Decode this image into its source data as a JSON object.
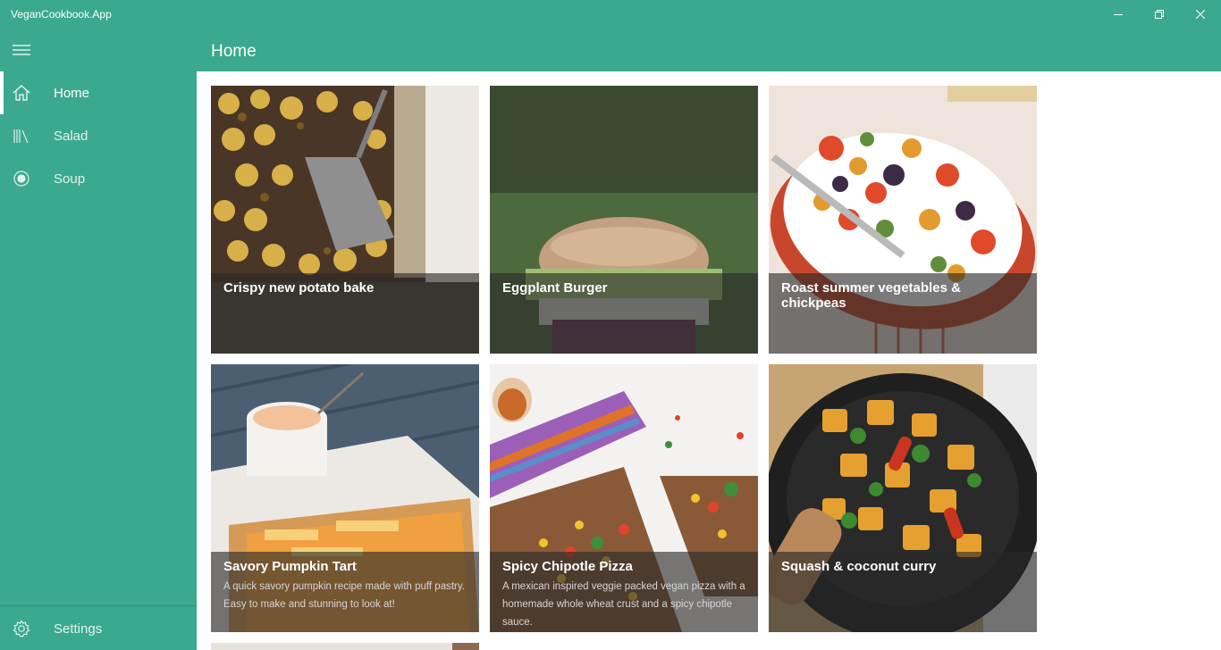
{
  "window": {
    "title": "VeganCookbook.App"
  },
  "header": {
    "title": "Home"
  },
  "sidebar": {
    "items": [
      {
        "label": "Home",
        "icon": "home-icon",
        "active": true
      },
      {
        "label": "Salad",
        "icon": "library-icon",
        "active": false
      },
      {
        "label": "Soup",
        "icon": "radio-button-icon",
        "active": false
      }
    ],
    "settings_label": "Settings"
  },
  "recipes": [
    {
      "title": "Crispy new potato bake",
      "description": ""
    },
    {
      "title": "Eggplant Burger",
      "description": ""
    },
    {
      "title": "Roast summer vegetables & chickpeas",
      "description": ""
    },
    {
      "title": "Savory Pumpkin Tart",
      "description": "A quick savory pumpkin recipe made with puff pastry. Easy to make and stunning to look at!"
    },
    {
      "title": "Spicy Chipotle Pizza",
      "description": "A mexican inspired veggie packed vegan pizza with a homemade whole wheat crust and a spicy chipotle sauce."
    },
    {
      "title": "Squash & coconut curry",
      "description": ""
    }
  ],
  "colors": {
    "accent": "#3aa98d",
    "content_bg": "#ffffff",
    "overlay": "rgba(40,40,40,0.62)"
  }
}
